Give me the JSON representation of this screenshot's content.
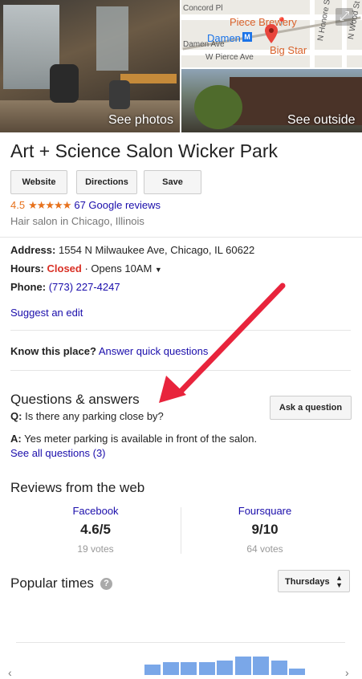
{
  "photos": {
    "see_photos": "See photos",
    "see_outside": "See outside"
  },
  "map": {
    "streets": [
      "Concord Pl",
      "Damen Ave",
      "W Pierce Ave",
      "N Honore St",
      "N Wood St"
    ],
    "pois": [
      "Piece Brewery",
      "Damen",
      "Big Star"
    ],
    "accent": "#e8453c",
    "metro_color": "#1a73e8"
  },
  "business": {
    "name": "Art + Science Salon Wicker Park",
    "buttons": {
      "website": "Website",
      "directions": "Directions",
      "save": "Save"
    },
    "rating": "4.5",
    "stars": "★★★★★",
    "reviews_link": "67 Google reviews",
    "category": "Hair salon in Chicago, Illinois"
  },
  "details": {
    "address_label": "Address:",
    "address": "1554 N Milwaukee Ave, Chicago, IL 60622",
    "hours_label": "Hours:",
    "hours_status": "Closed",
    "hours_sep": " · ",
    "hours_open": "Opens 10AM",
    "phone_label": "Phone:",
    "phone": "(773) 227-4247",
    "suggest_edit": "Suggest an edit"
  },
  "know": {
    "label": "Know this place?",
    "link": "Answer quick questions"
  },
  "qa": {
    "heading": "Questions & answers",
    "q_prefix": "Q:",
    "question": "Is there any parking close by?",
    "a_prefix": "A:",
    "answer": "Yes meter parking is available in front of the salon.",
    "see_all": "See all questions (3)",
    "ask_button": "Ask a question"
  },
  "reviews_web": {
    "heading": "Reviews from the web",
    "sources": [
      {
        "name": "Facebook",
        "score": "4.6/5",
        "votes": "19 votes"
      },
      {
        "name": "Foursquare",
        "score": "9/10",
        "votes": "64 votes"
      }
    ]
  },
  "popular": {
    "heading": "Popular times",
    "day": "Thursdays",
    "bar_color": "#7aa7e8",
    "bar_levels": [
      0.55,
      0.65,
      0.65,
      0.65,
      0.75,
      0.95,
      0.95,
      0.75,
      0.35
    ]
  },
  "annotation": {
    "arrow_color": "#e8243c"
  }
}
